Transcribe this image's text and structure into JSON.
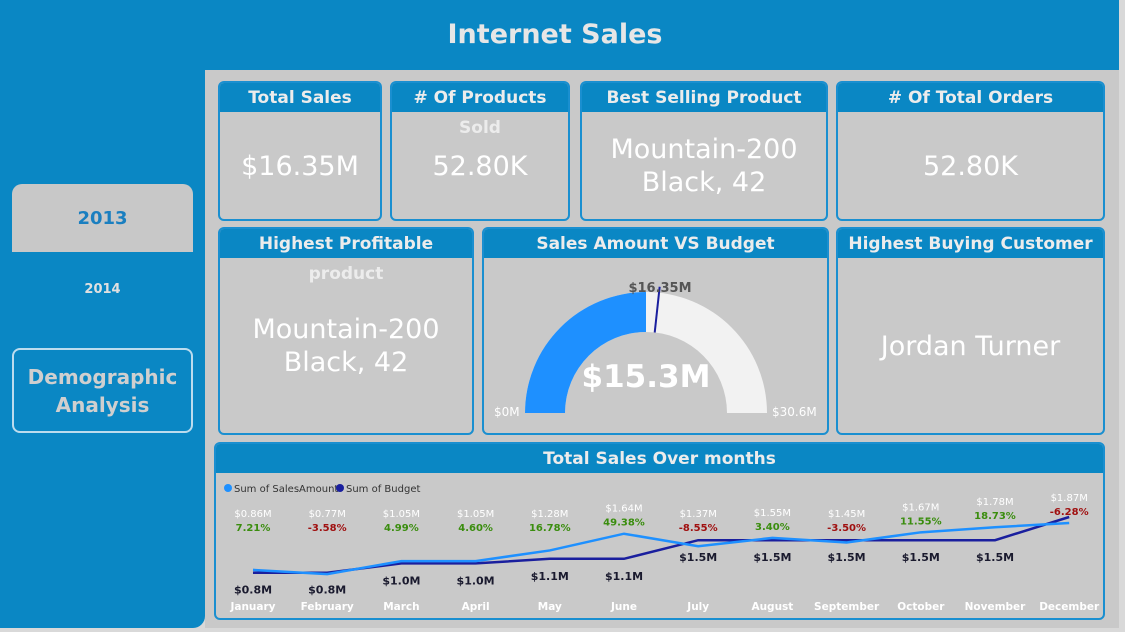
{
  "header": {
    "title": "Internet Sales"
  },
  "sidebar": {
    "years": [
      {
        "label": "2013",
        "selected": true
      },
      {
        "label": "2014",
        "selected": false
      }
    ],
    "demographic_button": "Demographic Analysis"
  },
  "cards": {
    "total_sales": {
      "title": "Total Sales",
      "value": "$16.35M"
    },
    "products_sold": {
      "title": "# Of Products Sold",
      "value": "52.80K"
    },
    "best_product": {
      "title": "Best Selling Product",
      "value": "Mountain-200 Black, 42"
    },
    "total_orders": {
      "title": "# Of Total Orders",
      "value": "52.80K"
    },
    "profitable_product": {
      "title": "Highest Profitable product",
      "value": "Mountain-200 Black, 42"
    },
    "top_customer": {
      "title": "Highest Buying Customer",
      "value": "Jordan Turner"
    }
  },
  "gauge": {
    "title": "Sales Amount VS Budget",
    "value_label": "$15.3M",
    "target_label": "$16.35M",
    "min_label": "$0M",
    "max_label": "$30.6M",
    "value": 15.3,
    "target": 16.35,
    "min": 0,
    "max": 30.6
  },
  "colors": {
    "primary": "#0a87c4",
    "sales_line": "#1e90ff",
    "budget_line": "#1a1f9e",
    "positive": "#3a8d0e",
    "negative": "#a01010"
  },
  "chart_data": {
    "type": "line",
    "title": "Total Sales Over months",
    "categories": [
      "January",
      "February",
      "March",
      "April",
      "May",
      "June",
      "July",
      "August",
      "September",
      "October",
      "November",
      "December"
    ],
    "series": [
      {
        "name": "Sum of SalesAmount",
        "values": [
          0.86,
          0.77,
          1.05,
          1.05,
          1.28,
          1.64,
          1.37,
          1.55,
          1.45,
          1.67,
          1.78,
          1.87
        ]
      },
      {
        "name": "Sum of Budget",
        "values": [
          0.8,
          0.8,
          1.0,
          1.0,
          1.1,
          1.1,
          1.5,
          1.5,
          1.5,
          1.5,
          1.5,
          2.0
        ]
      }
    ],
    "sales_labels": [
      "$0.86M",
      "$0.77M",
      "$1.05M",
      "$1.05M",
      "$1.28M",
      "$1.64M",
      "$1.37M",
      "$1.55M",
      "$1.45M",
      "$1.67M",
      "$1.78M",
      "$1.87M"
    ],
    "variance_labels": [
      "7.21%",
      "-3.58%",
      "4.99%",
      "4.60%",
      "16.78%",
      "49.38%",
      "-8.55%",
      "3.40%",
      "-3.50%",
      "11.55%",
      "18.73%",
      "-6.28%"
    ],
    "budget_labels": [
      "$0.8M",
      "$0.8M",
      "$1.0M",
      "$1.0M",
      "$1.1M",
      "$1.1M",
      "$1.5M",
      "$1.5M",
      "$1.5M",
      "$1.5M",
      "$1.5M",
      ""
    ],
    "ylim": [
      0.6,
      2.0
    ],
    "legend": "top-left",
    "grid": false
  }
}
